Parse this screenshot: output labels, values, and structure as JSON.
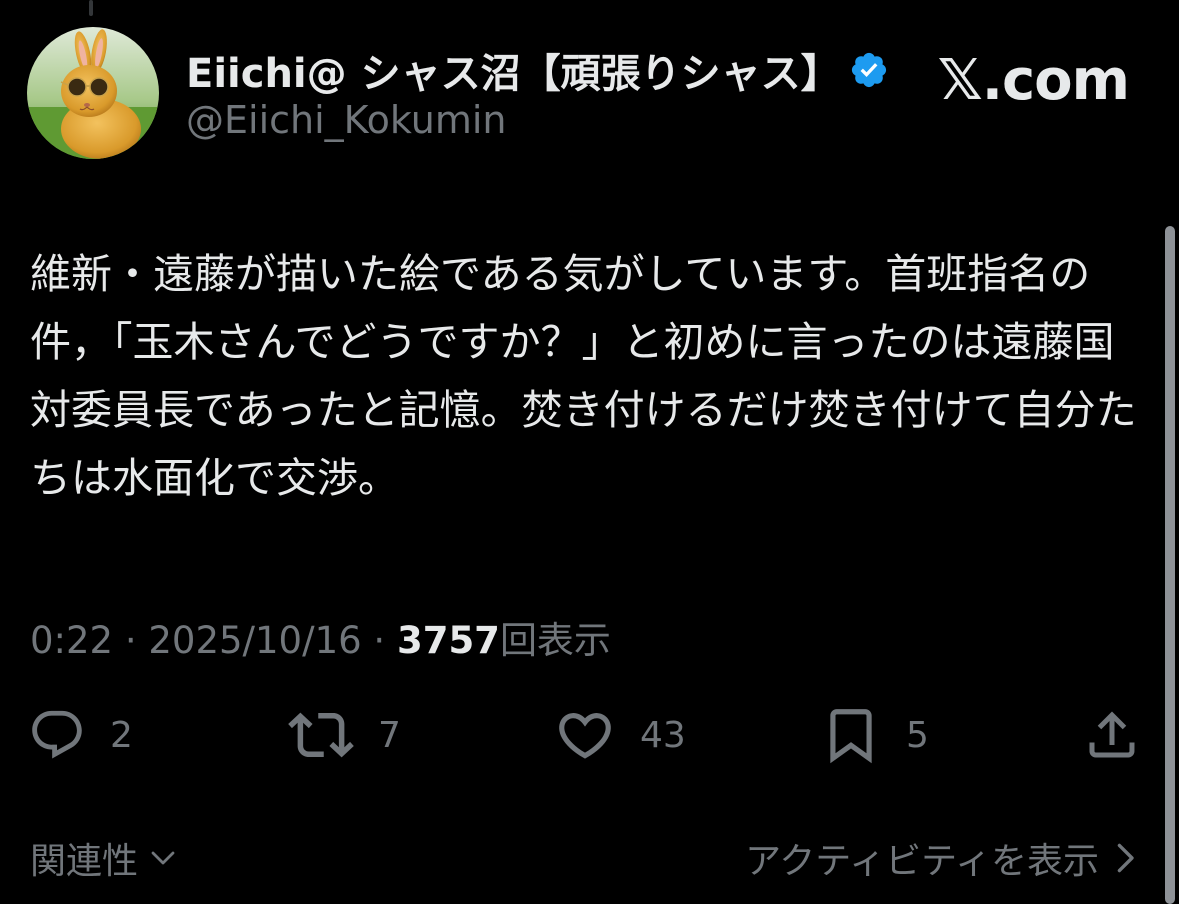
{
  "author": {
    "display_name": "Eiichi@ シャス沼【頑張りシャス】",
    "handle": "@Eiichi_Kokumin",
    "verified": true,
    "avatar_icon": "rabbit-with-sunglasses-avatar"
  },
  "site_logo": "𝕏.com",
  "tweet": {
    "text": "維新・遠藤が描いた絵である気がしています。首班指名の件，「玉木さんでどうですか？」と初めに言ったのは遠藤国対委員長であったと記憶。焚き付けるだけ焚き付けて自分たちは水面化で交渉。"
  },
  "meta": {
    "time": "0:22",
    "sep1": " · ",
    "date": "2025/10/16",
    "sep2": " · ",
    "views_count": "3757",
    "views_label": "回表示"
  },
  "actions": {
    "replies": "2",
    "retweets": "7",
    "likes": "43",
    "bookmarks": "5"
  },
  "footer": {
    "relevance_label": "関連性",
    "activity_label": "アクティビティを表示"
  },
  "colors": {
    "background": "#000000",
    "text_primary": "#e7e9ea",
    "text_secondary": "#71767b",
    "verified_blue": "#1d9bf0"
  }
}
